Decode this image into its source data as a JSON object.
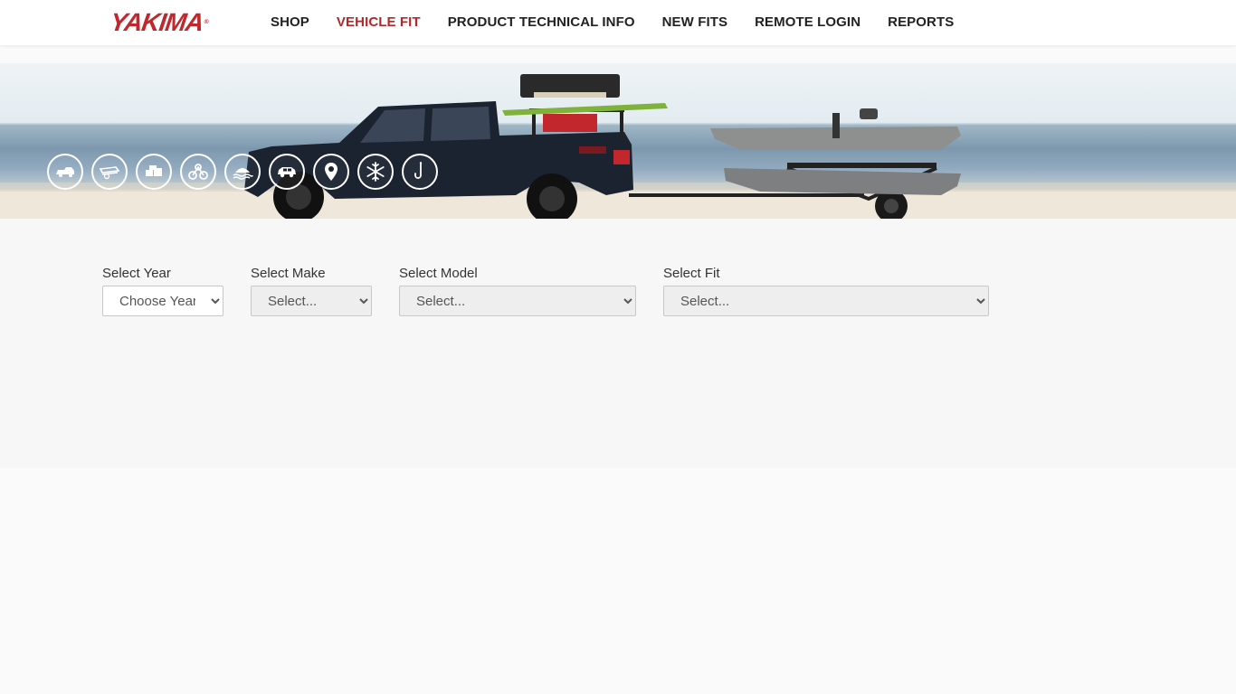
{
  "brand": {
    "name": "YAKIMA",
    "mark": "®",
    "color": "#c1272d"
  },
  "nav": {
    "items": [
      {
        "label": "SHOP",
        "active": false
      },
      {
        "label": "VEHICLE FIT",
        "active": true
      },
      {
        "label": "PRODUCT TECHNICAL INFO",
        "active": false
      },
      {
        "label": "NEW FITS",
        "active": false
      },
      {
        "label": "REMOTE LOGIN",
        "active": false
      },
      {
        "label": "REPORTS",
        "active": false
      }
    ],
    "active_color": "#b5262b"
  },
  "hero": {
    "category_icons": [
      "truck-rack-icon",
      "trailer-icon",
      "cargo-box-icon",
      "bike-icon",
      "water-sport-icon",
      "suv-icon",
      "location-pin-icon",
      "snowflake-icon",
      "hook-icon"
    ]
  },
  "form": {
    "year": {
      "label": "Select Year",
      "selected": "Choose Year"
    },
    "make": {
      "label": "Select Make",
      "selected": "Select..."
    },
    "model": {
      "label": "Select Model",
      "selected": "Select..."
    },
    "fit": {
      "label": "Select Fit",
      "selected": "Select..."
    }
  }
}
